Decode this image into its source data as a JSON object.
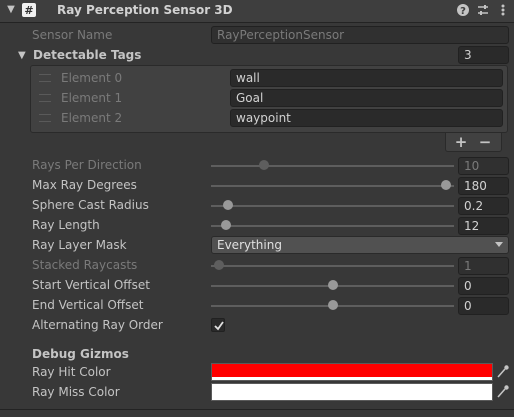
{
  "header": {
    "title": "Ray Perception Sensor 3D",
    "enabled": true
  },
  "sensor_name": {
    "label": "Sensor Name",
    "value": "RayPerceptionSensor"
  },
  "detectable_tags": {
    "label": "Detectable Tags",
    "count": "3",
    "elements": [
      {
        "label": "Element 0",
        "value": "wall"
      },
      {
        "label": "Element 1",
        "value": "Goal"
      },
      {
        "label": "Element 2",
        "value": "waypoint"
      }
    ],
    "add_label": "+",
    "remove_label": "−"
  },
  "rays_per_direction": {
    "label": "Rays Per Direction",
    "value": "10",
    "fraction": 0.2
  },
  "max_ray_degrees": {
    "label": "Max Ray Degrees",
    "value": "180",
    "fraction": 1.0
  },
  "sphere_cast_radius": {
    "label": "Sphere Cast Radius",
    "value": "0.2",
    "fraction": 0.04
  },
  "ray_length": {
    "label": "Ray Length",
    "value": "12",
    "fraction": 0.03
  },
  "ray_layer_mask": {
    "label": "Ray Layer Mask",
    "value": "Everything"
  },
  "stacked_raycasts": {
    "label": "Stacked Raycasts",
    "value": "1",
    "fraction": 0.0
  },
  "start_vertical_offset": {
    "label": "Start Vertical Offset",
    "value": "0",
    "fraction": 0.5
  },
  "end_vertical_offset": {
    "label": "End Vertical Offset",
    "value": "0",
    "fraction": 0.5
  },
  "alternating_ray_order": {
    "label": "Alternating Ray Order",
    "checked": true
  },
  "debug_gizmos": {
    "title": "Debug Gizmos",
    "ray_hit_color": {
      "label": "Ray Hit Color",
      "color": "#ff0000"
    },
    "ray_miss_color": {
      "label": "Ray Miss Color",
      "color": "#ffffff"
    }
  }
}
